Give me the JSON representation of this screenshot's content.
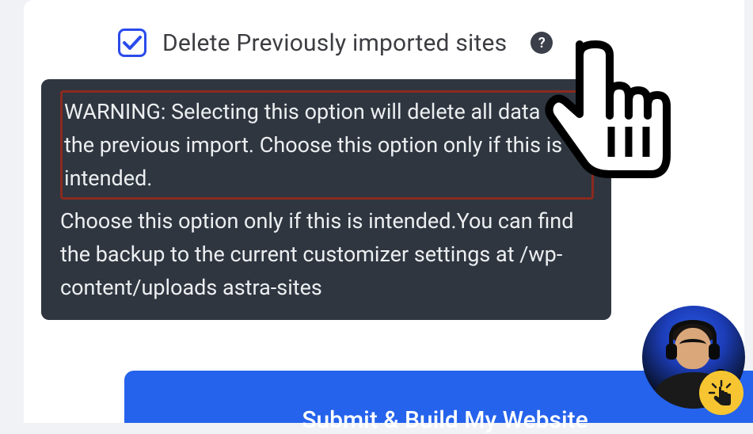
{
  "checkbox": {
    "label": "Delete Previously imported sites",
    "checked": true
  },
  "help": {
    "glyph": "?"
  },
  "tooltip": {
    "warning": "WARNING: Selecting this option will delete all data from the previous import. Choose this option only if this is intended.",
    "body": "Choose this option only if this is intended.You can find the backup to the current customizer settings at /wp-content/uploads astra-sites"
  },
  "submit": {
    "label": "Submit & Build My Website"
  }
}
